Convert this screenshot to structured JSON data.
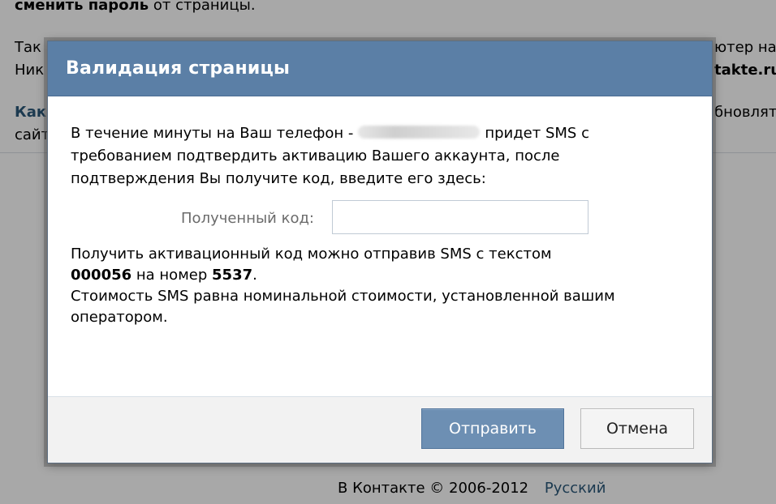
{
  "background": {
    "line1_bold": "сменить пароль",
    "line1_rest": "от страницы.",
    "line2_left": "Так",
    "line2_right": "ютер на",
    "line3_left": "Ник",
    "line3_right": "takte.ru",
    "line4_link": "Как",
    "line4_right": "бновлять",
    "line5_left": "сайт",
    "footer_copyright": "В Контакте © 2006-2012",
    "footer_language": "Русский"
  },
  "modal": {
    "title": "Валидация страницы",
    "instructions_part1": "В течение минуты на Ваш телефон -",
    "instructions_part2": "придет SMS с требованием подтвердить активацию Вашего аккаунта, после подтверждения Вы получите код, введите его здесь:",
    "code_label": "Полученный код:",
    "code_value": "",
    "sms_text_before": "Получить активационный код можно отправив SMS с текстом",
    "sms_code": "000056",
    "sms_to": "на номер",
    "sms_number": "5537",
    "sms_period": ".",
    "cost_note": "Стоимость SMS равна номинальной стоимости, установленной вашим оператором.",
    "send_button": "Отправить",
    "cancel_button": "Отмена"
  },
  "colors": {
    "header_bg": "#5b7fa6",
    "primary_button": "#6d8fb3",
    "link": "#2b587a"
  }
}
